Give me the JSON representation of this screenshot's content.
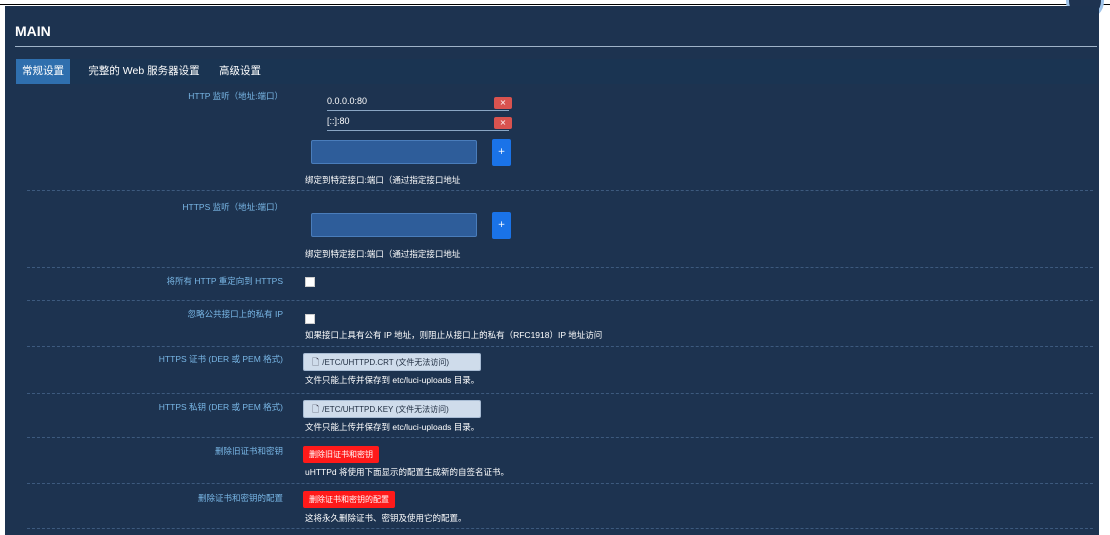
{
  "panel": {
    "title": "MAIN",
    "tabs": [
      {
        "label": "常规设置",
        "active": true
      },
      {
        "label": "完整的 Web 服务器设置",
        "active": false
      },
      {
        "label": "高级设置",
        "active": false
      }
    ]
  },
  "http_listen": {
    "label": "HTTP 监听（地址:端口）",
    "values": [
      "0.0.0.0:80",
      "[::]:80"
    ],
    "remove_label": "×",
    "add_label": "+",
    "desc": "绑定到特定接口:端口（通过指定接口地址"
  },
  "https_listen": {
    "label": "HTTPS 监听（地址:端口）",
    "add_label": "+",
    "desc": "绑定到特定接口:端口（通过指定接口地址"
  },
  "redirect_https": {
    "label": "将所有 HTTP 重定向到 HTTPS",
    "checked": false
  },
  "ignore_private": {
    "label": "忽略公共接口上的私有 IP",
    "checked": false,
    "desc": "如果接口上具有公有 IP 地址，则阻止从接口上的私有（RFC1918）IP 地址访问"
  },
  "https_cert": {
    "label": "HTTPS 证书 (DER 或 PEM 格式)",
    "button": "/ETC/UHTTPD.CRT (文件无法访问)",
    "desc": "文件只能上传并保存到 etc/luci-uploads 目录。"
  },
  "https_key": {
    "label": "HTTPS 私钥 (DER 或 PEM 格式)",
    "button": "/ETC/UHTTPD.KEY (文件无法访问)",
    "desc": "文件只能上传并保存到 etc/luci-uploads 目录。"
  },
  "remove_old": {
    "label": "删除旧证书和密钥",
    "button": "删除旧证书和密钥",
    "desc": "uHTTPd 将使用下面显示的配置生成新的自签名证书。"
  },
  "remove_conf": {
    "label": "删除证书和密钥的配置",
    "button": "删除证书和密钥的配置",
    "desc": "这将永久删除证书、密钥及使用它的配置。"
  },
  "icons": {
    "file": "file-icon",
    "remove": "close-icon",
    "add": "plus-icon"
  },
  "colors": {
    "panel_bg": "#1d3350",
    "tab_active": "#2f6fae",
    "label": "#79b7e6",
    "danger": "#ff1a1a",
    "primary": "#1a73e8"
  }
}
